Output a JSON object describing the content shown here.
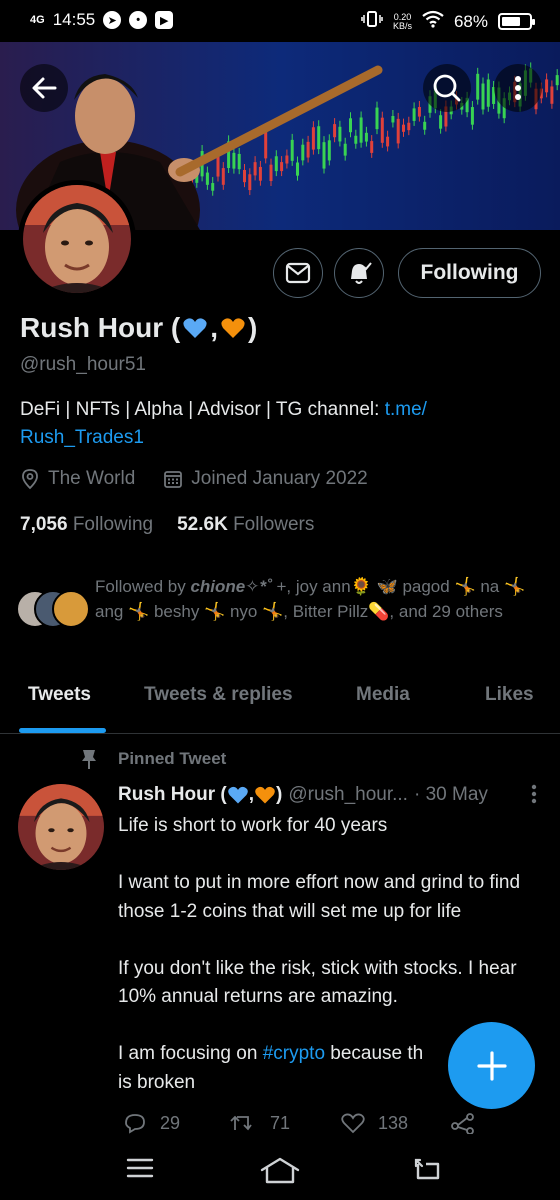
{
  "status_bar": {
    "network": "4G",
    "time": "14:55",
    "speed_top": "0.20",
    "speed_bottom": "KB/s",
    "battery": "68%",
    "battery_level": 0.68
  },
  "profile": {
    "name": "Rush Hour (",
    "name_sep": ",",
    "name_end": ")",
    "handle": "@rush_hour51",
    "bio_text": "DeFi | NFTs | Alpha | Advisor | TG channel: ",
    "bio_link": "t.me/\nRush_Trades1",
    "location": "The World",
    "joined": "Joined January 2022",
    "following_count": "7,056",
    "following_label": "Following",
    "followers_count": "52.6K",
    "followers_label": "Followers",
    "follow_button": "Following",
    "followed_by_prefix": "Followed by ",
    "followed_by_first": "chione✧*˚",
    "followed_by_rest": " +, joy ann🌻 🦋 pagod 🤸 na 🤸 ang 🤸 beshy 🤸 nyo 🤸, Bitter Pillz💊, and 29 others"
  },
  "tabs": [
    {
      "label": "Tweets",
      "active": true
    },
    {
      "label": "Tweets & replies",
      "active": false
    },
    {
      "label": "Media",
      "active": false
    },
    {
      "label": "Likes",
      "active": false
    }
  ],
  "pinned_tweet": {
    "pinned_label": "Pinned Tweet",
    "author_name": "Rush Hour (",
    "author_sep": ",",
    "author_end": ")",
    "author_handle": "@rush_hour...",
    "date": "· 30 May",
    "body_1": "Life is short to work for 40 years\n\nI want to put in more effort now and grind to find those 1-2 coins that will set me up for life\n\nIf you don't like the risk, stick with stocks. I hear 10% annual returns are amazing.\n\nI am focusing on ",
    "hashtag": "#crypto",
    "body_2": " because th\nis broken",
    "replies": "29",
    "retweets": "71",
    "likes": "138"
  },
  "colors": {
    "accent": "#1d9bf0",
    "background": "#000000",
    "muted": "#71767b",
    "heart_blue": "#5aa9f5",
    "heart_orange": "#f4900c"
  },
  "icons": [
    "back-arrow-icon",
    "search-icon",
    "more-vertical-icon",
    "mail-icon",
    "bell-plus-icon",
    "location-icon",
    "calendar-icon",
    "pin-icon",
    "reply-icon",
    "retweet-icon",
    "like-icon",
    "share-icon",
    "compose-plus-icon",
    "menu-icon",
    "home-icon",
    "back-icon"
  ]
}
